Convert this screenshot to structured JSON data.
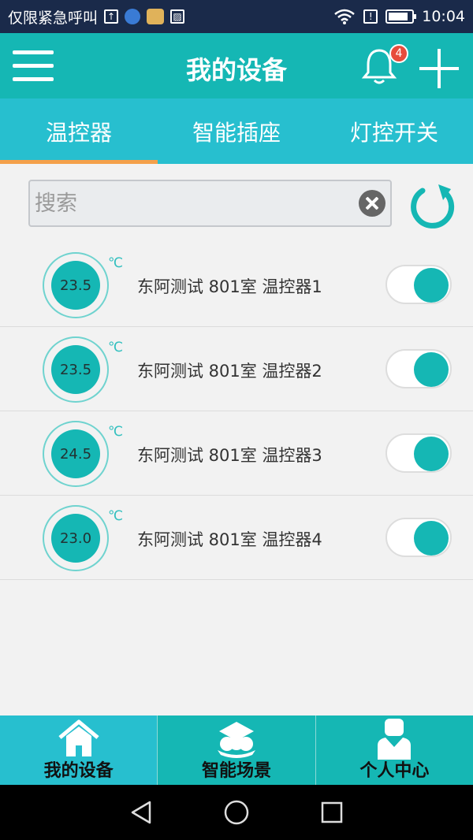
{
  "status_bar": {
    "carrier_text": "仅限紧急呼叫",
    "time": "10:04"
  },
  "app_bar": {
    "title": "我的设备",
    "notification_count": "4"
  },
  "tabs": [
    {
      "label": "温控器",
      "active": true
    },
    {
      "label": "智能插座",
      "active": false
    },
    {
      "label": "灯控开关",
      "active": false
    }
  ],
  "search": {
    "placeholder": "搜索",
    "value": ""
  },
  "devices": [
    {
      "temp": "23.5",
      "unit": "℃",
      "name": "东阿测试 801室 温控器1",
      "on": true
    },
    {
      "temp": "23.5",
      "unit": "℃",
      "name": "东阿测试 801室 温控器2",
      "on": true
    },
    {
      "temp": "24.5",
      "unit": "℃",
      "name": "东阿测试 801室 温控器3",
      "on": true
    },
    {
      "temp": "23.0",
      "unit": "℃",
      "name": "东阿测试 801室 温控器4",
      "on": true
    }
  ],
  "bottom_nav": [
    {
      "label": "我的设备",
      "icon": "home-icon",
      "active": true
    },
    {
      "label": "智能场景",
      "icon": "scene-icon",
      "active": false
    },
    {
      "label": "个人中心",
      "icon": "person-icon",
      "active": false
    }
  ],
  "colors": {
    "primary": "#15b7b4",
    "tab_bar": "#27bfcf",
    "tab_indicator": "#f4a04a",
    "badge": "#e74c3c"
  }
}
